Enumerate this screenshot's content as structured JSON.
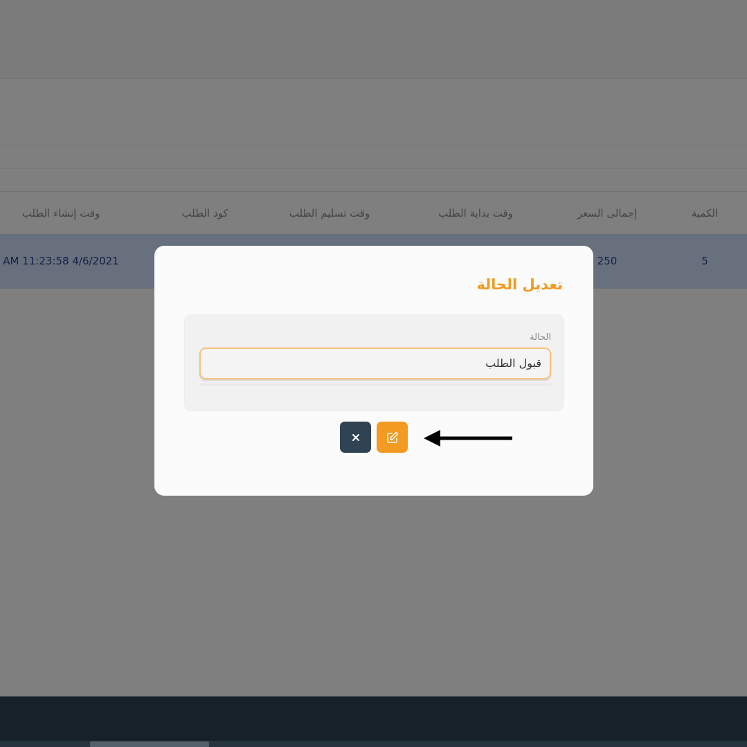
{
  "table": {
    "headers": {
      "quantity": "الكمية",
      "total_price": "إجمالى السعر",
      "start_time": "وقت بداية الطلب",
      "delivery_time": "وقت تسليم الطلب",
      "order_code": "كود الطلب",
      "created_time": "وقت إنشاء الطلب"
    },
    "row": {
      "quantity": "5",
      "total_price": "250",
      "created_time": "AM 11:23:58 4/6/2021"
    }
  },
  "modal": {
    "title": "تعديل الحالة",
    "field_label": "الحالة",
    "status_value": "قبول الطلب",
    "cancel_icon": "close-icon",
    "edit_icon": "edit-icon"
  },
  "colors": {
    "accent": "#f39a22",
    "dark": "#2f4352",
    "row_highlight": "#cfe0f8"
  }
}
